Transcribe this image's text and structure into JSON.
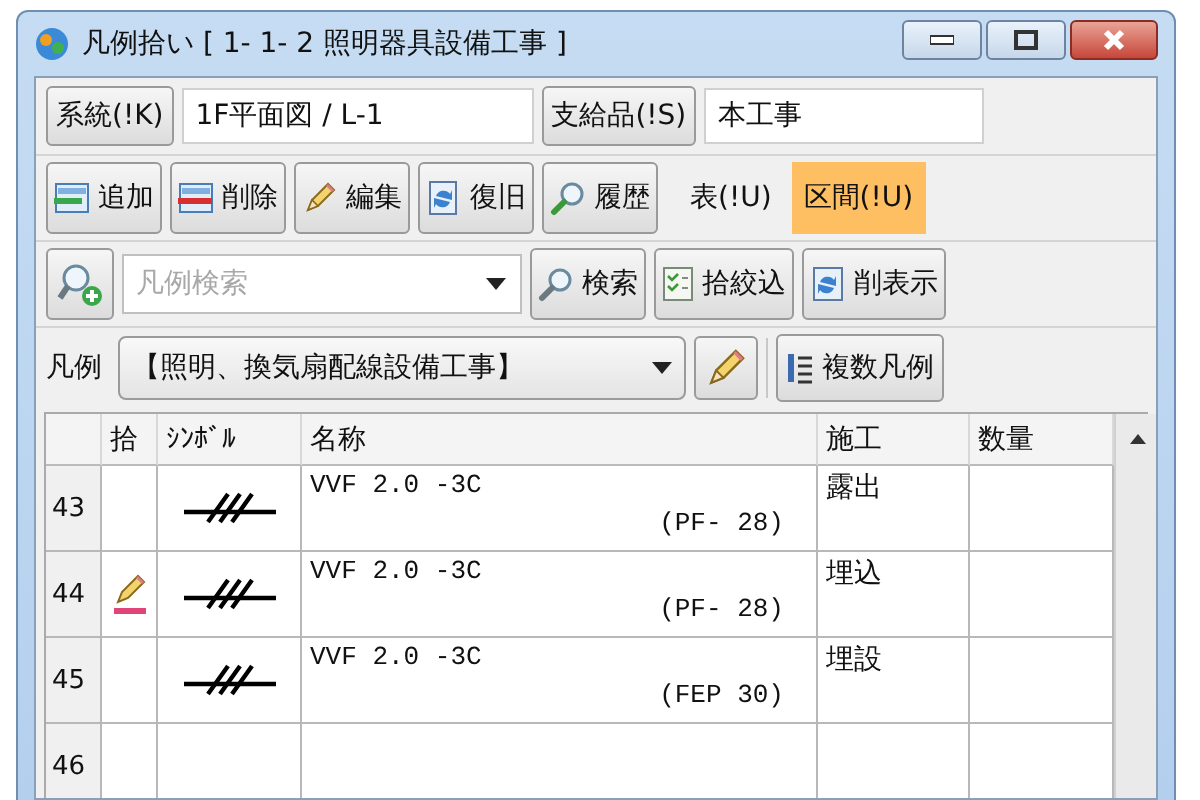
{
  "window": {
    "title": "凡例拾い [ 1- 1- 2  照明器具設備工事 ]"
  },
  "top_row": [
    {
      "kind": "button",
      "label": "系統(!K)"
    },
    {
      "kind": "field",
      "value": "1F平面図 / L-1"
    },
    {
      "kind": "button",
      "label": "支給品(!S)"
    },
    {
      "kind": "field",
      "value": "本工事"
    }
  ],
  "toolbar": [
    {
      "kind": "add",
      "label": "追加"
    },
    {
      "kind": "delete",
      "label": "削除"
    },
    {
      "kind": "edit",
      "label": "編集"
    },
    {
      "kind": "restore",
      "label": "復旧"
    },
    {
      "kind": "history",
      "label": "履歴"
    }
  ],
  "modes": [
    {
      "label": "表(!U)",
      "selected": false
    },
    {
      "label": "区間(!U)",
      "selected": true
    }
  ],
  "search": {
    "placeholder": "凡例検索",
    "buttons": [
      {
        "kind": "search",
        "label": "検索"
      },
      {
        "kind": "filter",
        "label": "拾絞込"
      },
      {
        "kind": "deleted",
        "label": "削表示"
      }
    ]
  },
  "legend": {
    "label": "凡例",
    "value": "【照明、換気扇配線設備工事】",
    "multi_button": "複数凡例"
  },
  "table": {
    "columns": [
      "拾",
      "ｼﾝﾎﾞﾙ",
      "名称",
      "施工",
      "数量"
    ],
    "rows": [
      {
        "number": "43",
        "picked": false,
        "name": "VVF 2.0 -3C",
        "conduit": "(PF- 28)",
        "method": "露出"
      },
      {
        "number": "44",
        "picked": true,
        "name": "VVF 2.0 -3C",
        "conduit": "(PF- 28)",
        "method": "埋込"
      },
      {
        "number": "45",
        "picked": false,
        "name": "VVF 2.0 -3C",
        "conduit": "(FEP 30)",
        "method": "埋設"
      },
      {
        "number": "46",
        "picked": false
      }
    ]
  }
}
